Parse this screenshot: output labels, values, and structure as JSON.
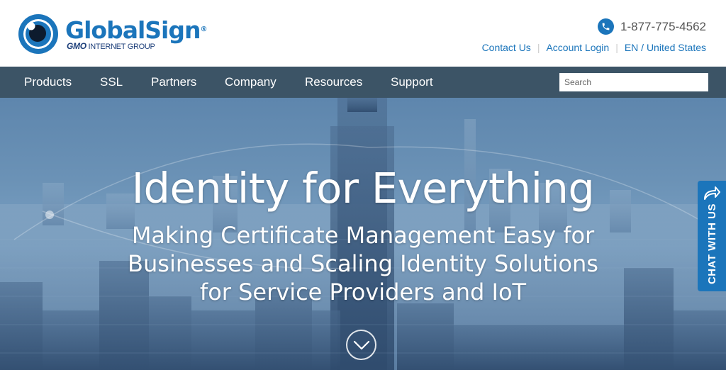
{
  "brand": {
    "name": "GlobalSign",
    "registered": "®",
    "sub_bold": "GMO",
    "sub_rest": "INTERNET GROUP",
    "blue": "#1b75bb"
  },
  "header": {
    "phone_icon": "phone-icon",
    "phone": "1-877-775-4562",
    "links": {
      "contact": "Contact Us",
      "account": "Account Login",
      "locale": "EN / United States"
    }
  },
  "nav": {
    "items": [
      "Products",
      "SSL",
      "Partners",
      "Company",
      "Resources",
      "Support"
    ],
    "search_placeholder": "Search",
    "background": "#3c5466"
  },
  "hero": {
    "title": "Identity for Everything",
    "subtitle_line1": "Making Certificate Management Easy for",
    "subtitle_line2": "Businesses and Scaling Identity Solutions",
    "subtitle_line3": "for Service Providers and IoT",
    "scroll_icon": "chevron-down-icon"
  },
  "chat": {
    "label": "CHAT WITH US",
    "icon": "share-arrow-icon"
  }
}
